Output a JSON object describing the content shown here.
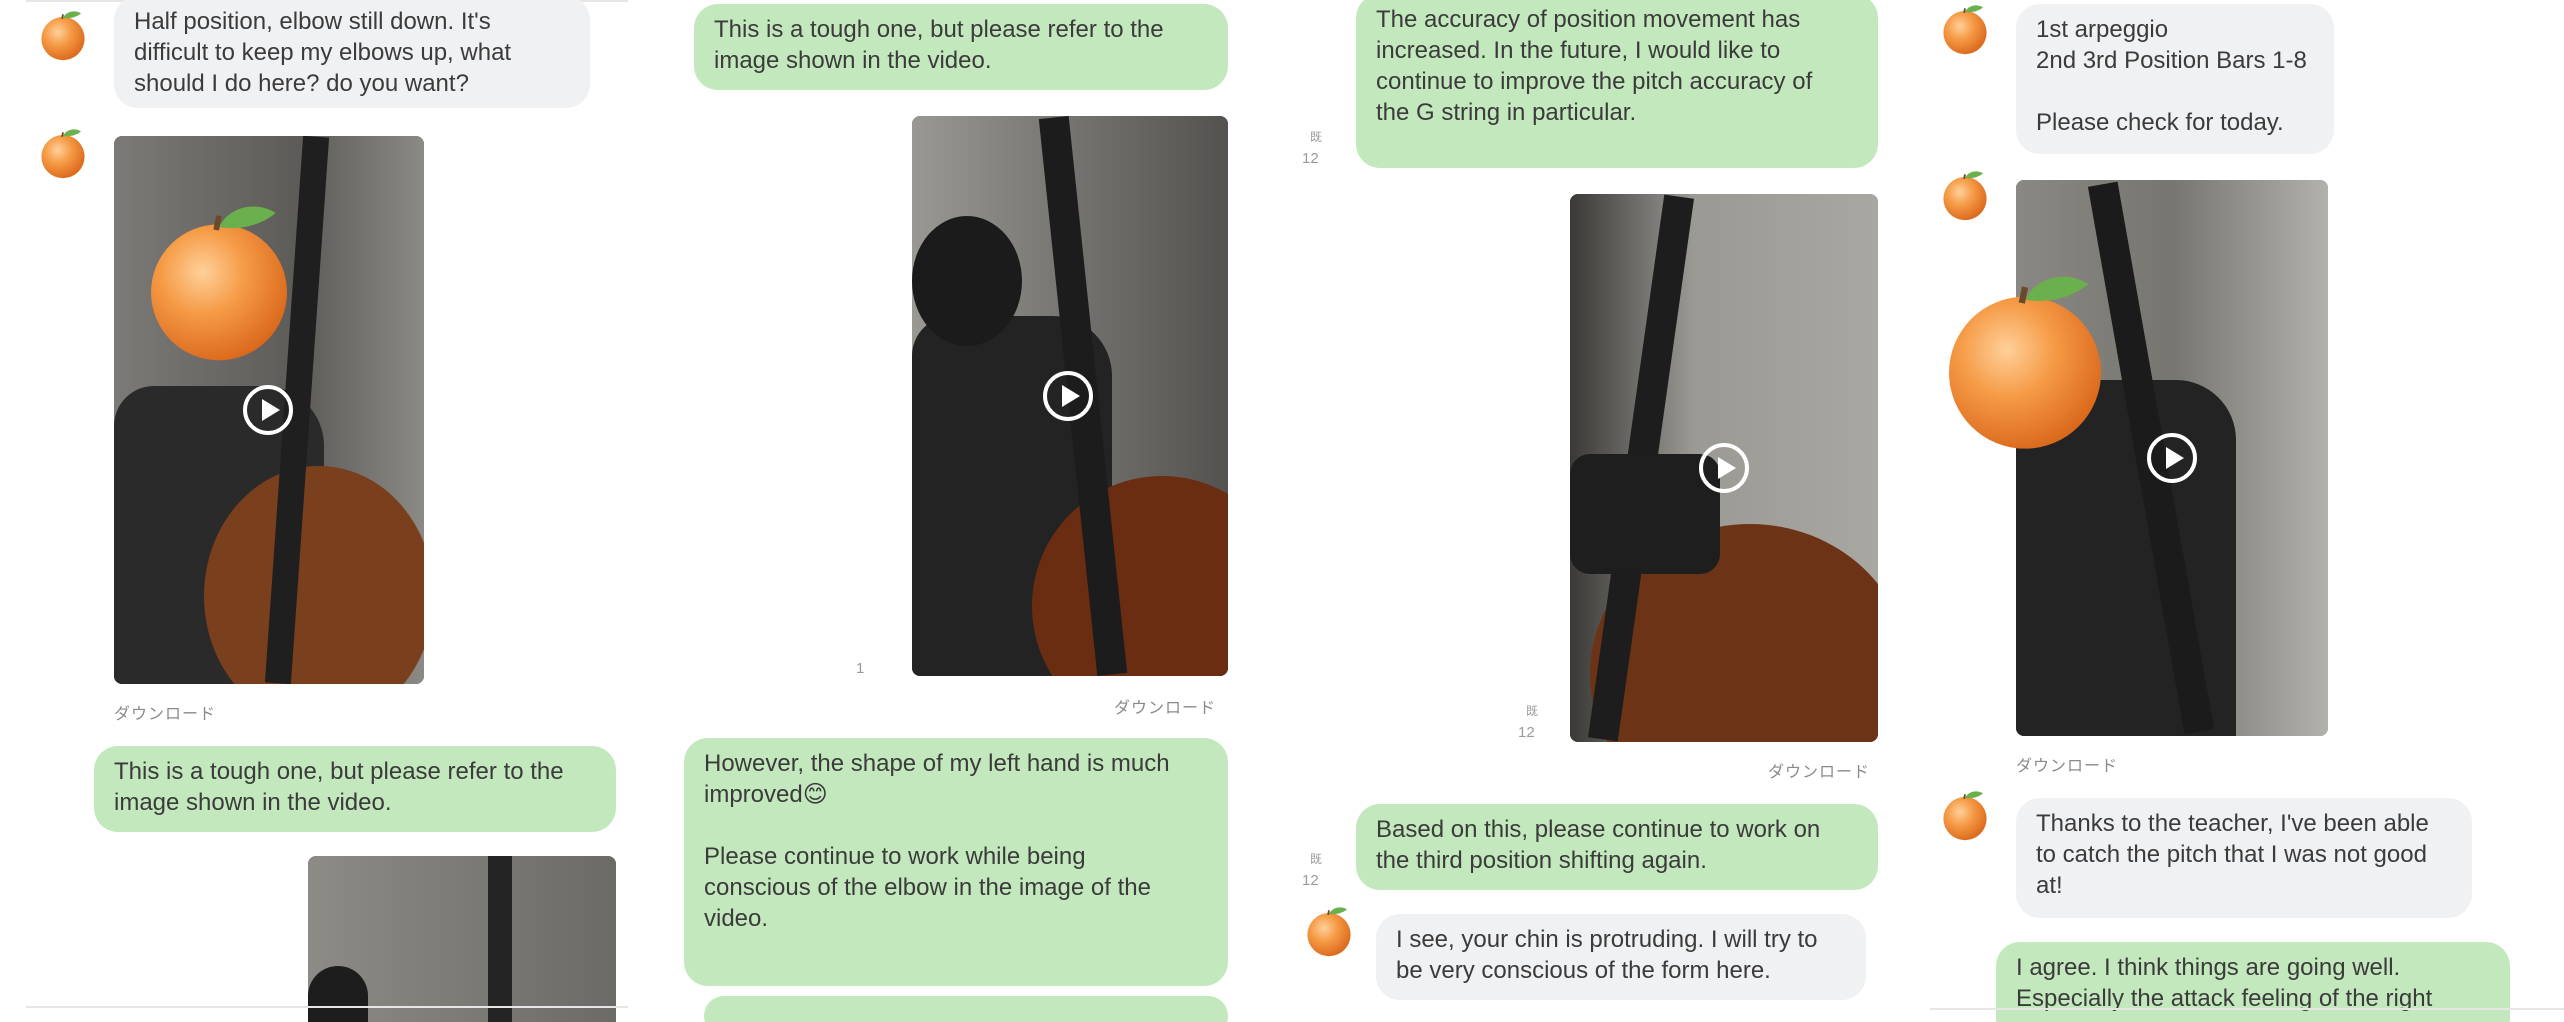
{
  "download_label": "ダウンロード",
  "colors": {
    "incoming_bubble": "#f0f1f3",
    "outgoing_bubble": "#c4e8bd",
    "text": "#3b3b3b",
    "meta": "#8a8a8a"
  },
  "icons": {
    "avatar": "orange-emoji-icon",
    "video": "play-icon"
  },
  "panel1": {
    "msg1_lines": [
      "Half position, elbow still down. It's",
      "difficult to keep my elbows up, what",
      "should I do here? do you want?"
    ],
    "msg2_lines": [
      "This is a tough one, but please refer to the",
      "image shown in the video."
    ]
  },
  "panel2": {
    "msg1_lines": [
      "This is a tough one, but please refer to the",
      "image shown in the video."
    ],
    "video_meta": "1",
    "msg2_lines": [
      "However, the shape of my left hand is much",
      "improved😊",
      "",
      "Please continue to work while being",
      "conscious of the elbow in the image of the",
      "video."
    ]
  },
  "panel3": {
    "msg1_lines": [
      "The accuracy of position movement has",
      "increased. In the future, I would like to",
      "continue to improve the pitch accuracy of",
      "the G string in particular."
    ],
    "meta1_a": "既",
    "meta1_b": "12",
    "video_meta_a": "既",
    "video_meta_b": "12",
    "msg2_lines": [
      "Based on this, please continue to work on",
      "the third position shifting again."
    ],
    "meta2_a": "既",
    "meta2_b": "12",
    "msg3_lines": [
      "I see, your chin is protruding. I will try to",
      "be very conscious of the form here."
    ]
  },
  "panel4": {
    "msg1_lines": [
      "1st arpeggio",
      "2nd 3rd Position Bars 1-8",
      "",
      "Please check for today."
    ],
    "msg2_lines": [
      "Thanks to the teacher, I've been able",
      "to catch the pitch that I was not good",
      "at!"
    ],
    "msg3_lines": [
      "I agree. I think things are going well.",
      "Especially the attack feeling of the right"
    ]
  }
}
